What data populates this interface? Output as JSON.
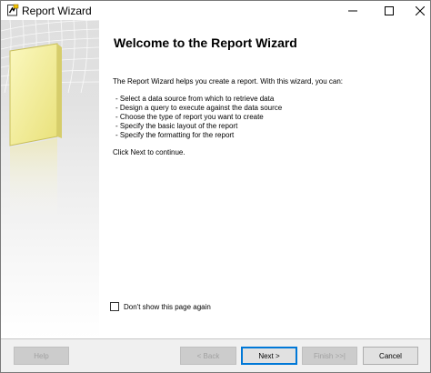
{
  "window": {
    "title": "Report Wizard",
    "controls": {
      "minimize": "minimize-icon",
      "maximize": "maximize-icon",
      "close": "close-icon"
    }
  },
  "main": {
    "title": "Welcome to the Report Wizard",
    "intro": "The Report Wizard helps you create a report. With this wizard, you can:",
    "bullets": [
      "- Select a data source from which to retrieve data",
      "- Design a query to execute against the data source",
      "- Choose the type of report you want to create",
      "- Specify the basic layout of the report",
      "- Specify the formatting for the report"
    ],
    "footer_text": "Click Next to continue.",
    "dont_show": {
      "label": "Don't show this page again",
      "checked": false
    }
  },
  "buttons": {
    "help": "Help",
    "back": "< Back",
    "next": "Next >",
    "finish": "Finish >>|",
    "cancel": "Cancel"
  },
  "colors": {
    "accent_border": "#0078d7",
    "button_bar_bg": "#f0f0f0",
    "panel_page": "#f3ef9e"
  }
}
